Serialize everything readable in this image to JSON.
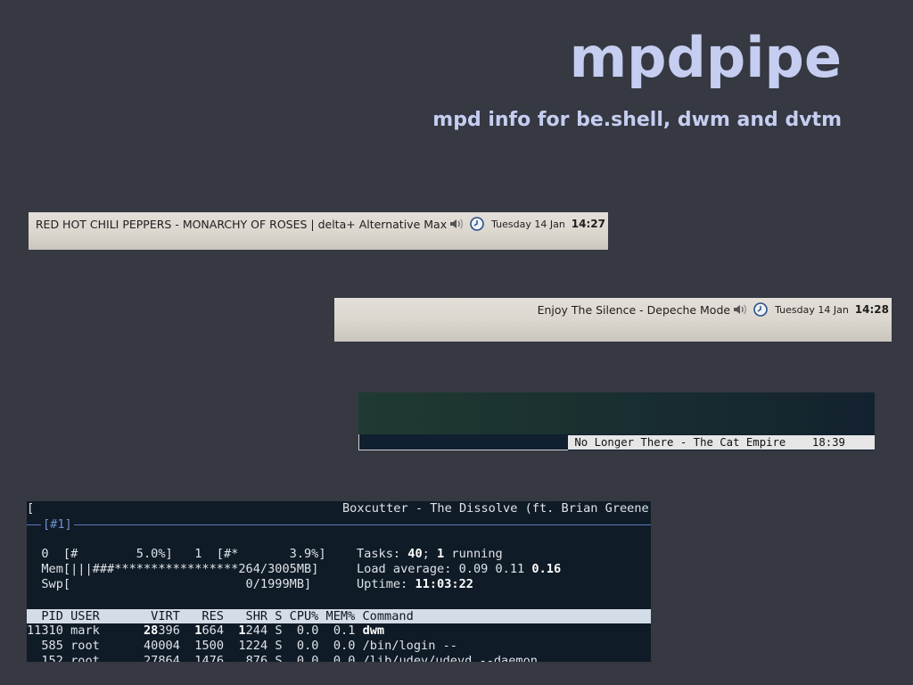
{
  "header": {
    "title": "mpdpipe",
    "subtitle": "mpd info for be.shell, dwm and dvtm"
  },
  "beshell_bar_1": {
    "track": "RED HOT CHILI PEPPERS - MONARCHY OF ROSES | delta+ Alternative Max",
    "date": "Tuesday 14 Jan",
    "time": "14:27",
    "icons": [
      "speaker-icon",
      "clock-icon"
    ]
  },
  "beshell_bar_2": {
    "track": "Enjoy The Silence - Depeche Mode",
    "date": "Tuesday 14 Jan",
    "time": "14:28",
    "icons": [
      "speaker-icon",
      "clock-icon"
    ]
  },
  "dwm_bar": {
    "status": " No Longer There - The Cat Empire    18:39"
  },
  "dvtm": {
    "title_left": "[",
    "title_right": "Boxcutter - The Dissolve (ft. Brian Greene)]",
    "tag": "[#1]",
    "htop": {
      "cpu0": "  0  [#        5.0%]   1  [#*       3.9%]",
      "mem": "  Mem[|||###*****************264/3005MB]",
      "swp": "  Swp[                        0/1999MB]",
      "tasks_label": "Tasks: ",
      "tasks_count": "40",
      "tasks_sep": "; ",
      "tasks_running": "1",
      "tasks_suffix": " running",
      "load_label": "Load average: 0.09 0.11 ",
      "load_last": "0.16",
      "uptime_label": "Uptime: ",
      "uptime_value": "11:03:22",
      "columns": "  PID USER       VIRT   RES   SHR S CPU% MEM% Command",
      "rows": [
        {
          "pid": "11310",
          "user": "mark",
          "virt": "28396",
          "res": "1664",
          "shr": "1244",
          "s": "S",
          "cpu": "0.0",
          "mem": "0.1",
          "cmd": "dwm"
        },
        {
          "pid": "585",
          "user": "root",
          "virt": "40004",
          "res": "1500",
          "shr": "1224",
          "s": "S",
          "cpu": "0.0",
          "mem": "0.0",
          "cmd": "/bin/login --"
        },
        {
          "pid": "152",
          "user": "root",
          "virt": "27864",
          "res": "1476",
          "shr": "876",
          "s": "S",
          "cpu": "0.0",
          "mem": "0.0",
          "cmd": "/lib/udev/udevd --daemon"
        }
      ]
    }
  },
  "colors": {
    "background": "#363842",
    "title": "#c5cef0",
    "terminal_bg": "#0f1b26",
    "terminal_sep": "#5a79b8",
    "htop_header_bg": "#d3dde8"
  }
}
